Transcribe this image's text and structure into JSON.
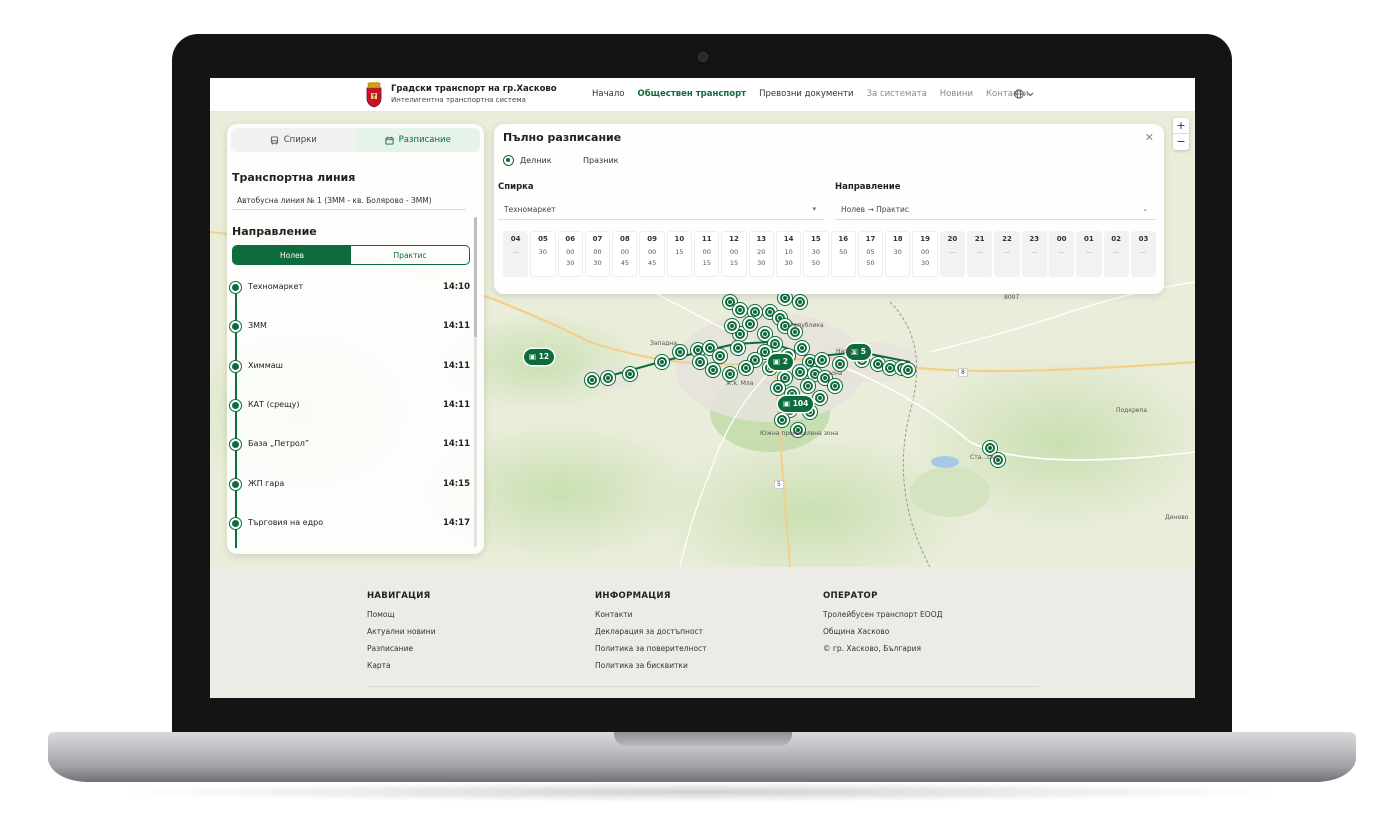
{
  "header": {
    "brand_title": "Градски транспорт на гр.Хасково",
    "brand_sub": "Интелигентна транспортна система",
    "nav": [
      {
        "label": "Начало",
        "state": "normal"
      },
      {
        "label": "Обществен транспорт",
        "state": "active"
      },
      {
        "label": "Превозни документи",
        "state": "normal"
      },
      {
        "label": "За системата",
        "state": "muted"
      },
      {
        "label": "Новини",
        "state": "muted"
      },
      {
        "label": "Контакти",
        "state": "muted"
      }
    ],
    "language_icon": "globe-icon"
  },
  "left_panel": {
    "tabs": [
      {
        "label": "Спирки",
        "icon": "bus-icon",
        "active": false
      },
      {
        "label": "Разписание",
        "icon": "calendar-icon",
        "active": true
      }
    ],
    "line_heading": "Транспортна линия",
    "line_value": "Автобусна линия № 1 (ЗММ - кв. Болярово - ЗММ)",
    "direction_heading": "Направление",
    "directions": [
      {
        "label": "Нолев",
        "active": true
      },
      {
        "label": "Практис",
        "active": false
      }
    ],
    "stops": [
      {
        "name": "Техномаркет",
        "time": "14:10"
      },
      {
        "name": "ЗММ",
        "time": "14:11"
      },
      {
        "name": "Химмаш",
        "time": "14:11"
      },
      {
        "name": "КАТ (срещу)",
        "time": "14:11"
      },
      {
        "name": "База „Петрол”",
        "time": "14:11"
      },
      {
        "name": "ЖП гара",
        "time": "14:15"
      },
      {
        "name": "Търговия на едро",
        "time": "14:17"
      }
    ]
  },
  "schedule": {
    "title": "Пълно разписание",
    "close_icon": "close-icon",
    "day_types": [
      {
        "label": "Делник",
        "selected": true
      },
      {
        "label": "Празник",
        "selected": false
      }
    ],
    "stop_label": "Спирка",
    "stop_value": "Техномаркет",
    "direction_label": "Направление",
    "direction_value": "Нолев → Практис",
    "hours": [
      {
        "h": "04",
        "m": [
          "—"
        ]
      },
      {
        "h": "05",
        "m": [
          "30"
        ]
      },
      {
        "h": "06",
        "m": [
          "00",
          "30"
        ]
      },
      {
        "h": "07",
        "m": [
          "00",
          "30"
        ]
      },
      {
        "h": "08",
        "m": [
          "00",
          "45"
        ]
      },
      {
        "h": "09",
        "m": [
          "00",
          "45"
        ]
      },
      {
        "h": "10",
        "m": [
          "15"
        ]
      },
      {
        "h": "11",
        "m": [
          "00",
          "15"
        ]
      },
      {
        "h": "12",
        "m": [
          "00",
          "15"
        ]
      },
      {
        "h": "13",
        "m": [
          "20",
          "30"
        ]
      },
      {
        "h": "14",
        "m": [
          "10",
          "30"
        ]
      },
      {
        "h": "15",
        "m": [
          "30",
          "50"
        ]
      },
      {
        "h": "16",
        "m": [
          "50"
        ]
      },
      {
        "h": "17",
        "m": [
          "05",
          "50"
        ]
      },
      {
        "h": "18",
        "m": [
          "30"
        ]
      },
      {
        "h": "19",
        "m": [
          "00",
          "30"
        ]
      },
      {
        "h": "20",
        "m": [
          "—"
        ]
      },
      {
        "h": "21",
        "m": [
          "—"
        ]
      },
      {
        "h": "22",
        "m": [
          "—"
        ]
      },
      {
        "h": "23",
        "m": [
          "—"
        ]
      },
      {
        "h": "00",
        "m": [
          "—"
        ]
      },
      {
        "h": "01",
        "m": [
          "—"
        ]
      },
      {
        "h": "02",
        "m": [
          "—"
        ]
      },
      {
        "h": "03",
        "m": [
          "—"
        ]
      }
    ]
  },
  "map": {
    "clusters": [
      "12",
      "2",
      "5",
      "104"
    ],
    "place_labels": [
      "Западна",
      "Република",
      "Нагрев",
      "ж.к. Мла",
      "Южна промишлена зона",
      "Подкрепа",
      "Ста...ски",
      "Динево",
      "8007",
      "зона"
    ],
    "road_labels": [
      "5",
      "8"
    ],
    "zoom_in": "+",
    "zoom_out": "−"
  },
  "footer": {
    "columns": [
      {
        "heading": "НАВИГАЦИЯ",
        "links": [
          "Помощ",
          "Актуални новини",
          "Разписание",
          "Карта"
        ]
      },
      {
        "heading": "ИНФОРМАЦИЯ",
        "links": [
          "Контакти",
          "Декларация за достъпност",
          "Политика за поверителност",
          "Политика за бисквитки"
        ]
      },
      {
        "heading": "ОПЕРАТОР",
        "links": [
          "Тролейбусен транспорт ЕООД",
          "Община Хасково",
          "© гр. Хасково, България"
        ]
      }
    ]
  },
  "colors": {
    "accent": "#0d6b3c",
    "map_bg": "#e8ecd8",
    "footer_bg": "#ecebe6"
  }
}
